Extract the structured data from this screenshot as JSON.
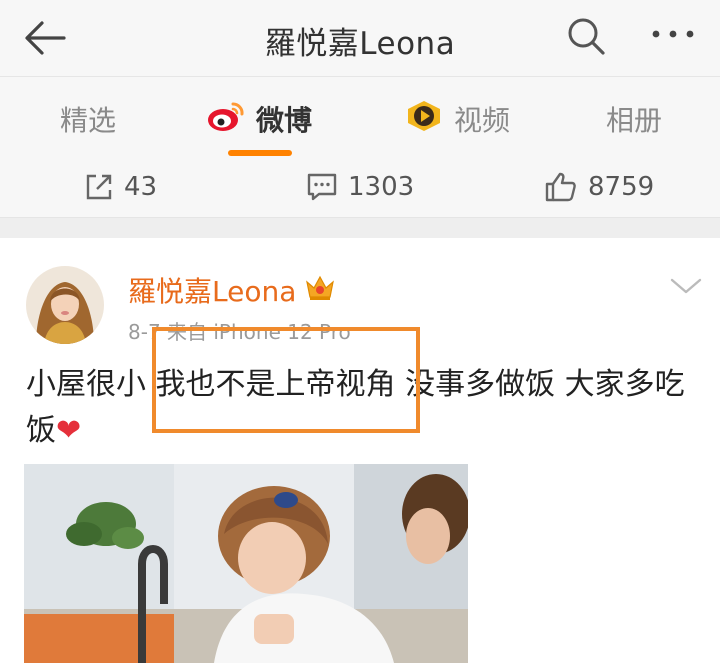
{
  "header": {
    "title": "羅悦嘉Leona",
    "back_icon": "arrow-left-icon",
    "search_icon": "search-icon",
    "more_icon": "more-dots-icon"
  },
  "tabs": [
    {
      "label": "精选",
      "active": false
    },
    {
      "label": "微博",
      "active": true,
      "icon": "weibo-logo-icon"
    },
    {
      "label": "视频",
      "active": false,
      "icon": "video-play-icon"
    },
    {
      "label": "相册",
      "active": false
    }
  ],
  "stats": {
    "repost": {
      "icon": "share-icon",
      "count": "43"
    },
    "comment": {
      "icon": "comment-icon",
      "count": "1303"
    },
    "like": {
      "icon": "thumbs-up-icon",
      "count": "8759"
    }
  },
  "post": {
    "author": "羅悦嘉Leona",
    "badge_icon": "crown-badge-icon",
    "meta": "8-7   来自 iPhone 12 Pro",
    "text_before": "小屋很小 ",
    "text_highlight": "我也不是上帝视角",
    "text_after": " 没事多做饭 大家多吃饭",
    "heart": "❤",
    "chevron_icon": "chevron-down-icon"
  },
  "colors": {
    "accent": "#ff8200",
    "author": "#e86b1c",
    "highlight": "#f08a2c",
    "heart": "#e5303b"
  }
}
